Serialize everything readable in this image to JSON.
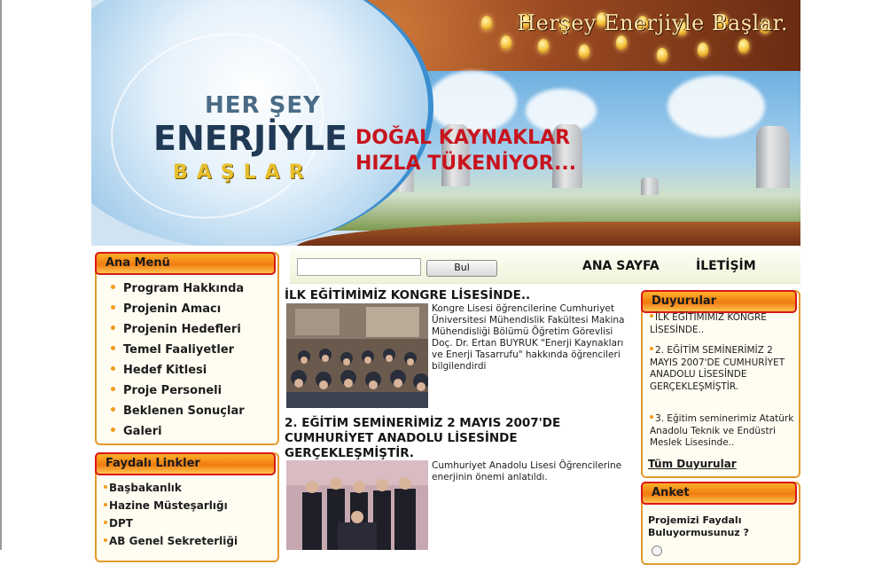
{
  "banner": {
    "slogan": "Herşey Enerjiyle Başlar.",
    "brand_line1": "HER ŞEY",
    "brand_line2": "ENERJİYLE",
    "brand_line3": "BAŞLAR",
    "headline_line1": "DOĞAL KAYNAKLAR",
    "headline_line2": "HIZLA TÜKENİYOR..."
  },
  "nav": {
    "search_placeholder": "",
    "search_button": "Bul",
    "links": [
      "ANA SAYFA",
      "İLETİŞİM"
    ]
  },
  "main_menu": {
    "title": "Ana Menü",
    "items": [
      "Program Hakkında",
      "Projenin Amacı",
      "Projenin Hedefleri",
      "Temel Faaliyetler",
      "Hedef Kitlesi",
      "Proje Personeli",
      "Beklenen Sonuçlar",
      "Galeri"
    ]
  },
  "useful_links": {
    "title": "Faydalı Linkler",
    "items": [
      "Başbakanlık",
      "Hazine Müsteşarlığı",
      "DPT",
      "AB Genel Sekreterliği"
    ]
  },
  "news": [
    {
      "title": "İLK EĞİTİMİMİZ KONGRE LİSESİNDE..",
      "text": "Kongre Lisesi öğrencilerine Cumhuriyet Üniversitesi Mühendislik Fakültesi Makina Mühendisliği Bölümü Öğretim Görevlisi Doç. Dr. Ertan BUYRUK \"Enerji Kaynakları ve Enerji Tasarrufu\" hakkında öğrencileri bilgilendirdi"
    },
    {
      "title": "2. EĞİTİM SEMİNERİMİZ 2 MAYIS 2007'DE CUMHURİYET ANADOLU LİSESİNDE GERÇEKLEŞMİŞTİR.",
      "text": "Cumhuriyet Anadolu Lisesi Öğrencilerine enerjinin önemi anlatıldı."
    }
  ],
  "announcements": {
    "title": "Duyurular",
    "items": [
      "İLK EĞİTİMİMİZ KONGRE LİSESİNDE..",
      "2. EĞİTİM SEMİNERİMİZ 2 MAYIS 2007'DE CUMHURİYET ANADOLU LİSESİNDE GERÇEKLEŞMİŞTİR.",
      "3. Eğitim seminerimiz Atatürk Anadolu Teknik ve Endüstri Meslek Lisesinde.."
    ],
    "all_link": "Tüm Duyurular"
  },
  "poll": {
    "title": "Anket",
    "question": "Projemizi Faydalı Buluyormusunuz ?"
  },
  "colors": {
    "box_border": "#e29a2a",
    "box_head_border": "#d81818",
    "box_head": "#f07c10",
    "headline_red": "#c8141e",
    "bullet": "#f29a18"
  }
}
